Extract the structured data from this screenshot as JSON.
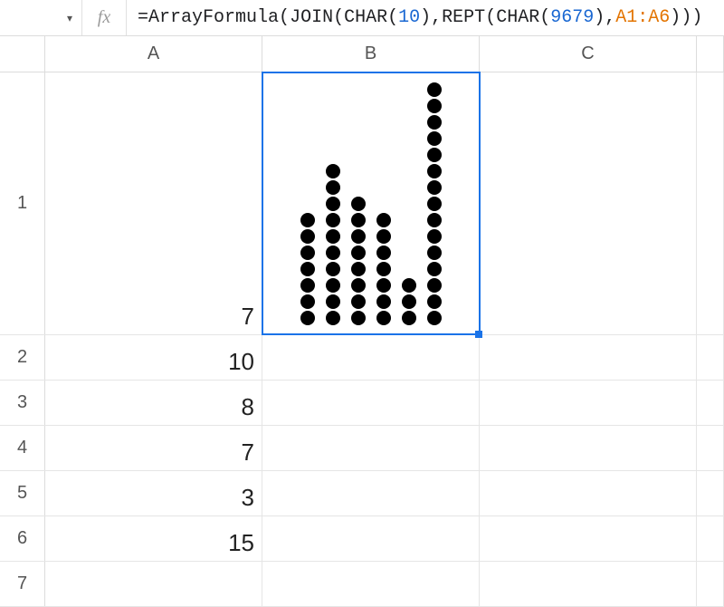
{
  "formula_bar": {
    "fx_label": "fx",
    "tokens": {
      "eq": "=",
      "fn1": "ArrayFormula",
      "p1": "(",
      "fn2": "JOIN",
      "p2": "(",
      "fn3": "CHAR",
      "p3": "(",
      "num1": "10",
      "p4": ")",
      "comma1": ",",
      "fn4": "REPT",
      "p5": "(",
      "fn5": "CHAR",
      "p6": "(",
      "num2": "9679",
      "p7": ")",
      "comma2": ",",
      "range": "A1:A6",
      "p8": ")",
      "p9": ")",
      "p10": ")"
    }
  },
  "columns": {
    "A": "A",
    "B": "B",
    "C": "C"
  },
  "row_labels": {
    "r1": "1",
    "r2": "2",
    "r3": "3",
    "r4": "4",
    "r5": "5",
    "r6": "6",
    "r7": "7"
  },
  "cells": {
    "A1": "7",
    "A2": "10",
    "A3": "8",
    "A4": "7",
    "A5": "3",
    "A6": "15"
  },
  "chart_data": {
    "type": "bar",
    "categories": [
      "A1",
      "A2",
      "A3",
      "A4",
      "A5",
      "A6"
    ],
    "values": [
      7,
      10,
      8,
      7,
      3,
      15
    ],
    "title": "",
    "xlabel": "",
    "ylabel": "",
    "ylim": [
      0,
      15
    ]
  }
}
